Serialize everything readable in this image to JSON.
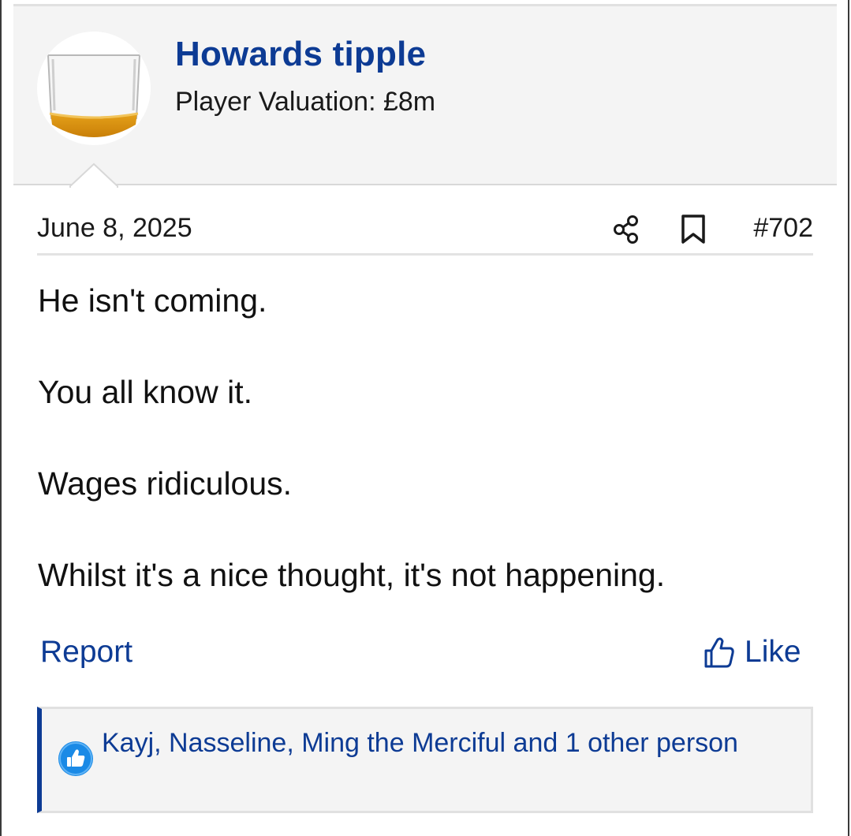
{
  "user": {
    "name": "Howards tipple",
    "title": "Player Valuation: £8m",
    "avatar_icon": "whisky-glass-avatar"
  },
  "post": {
    "date": "June 8, 2025",
    "number": "#702",
    "share_icon": "share-icon",
    "bookmark_icon": "bookmark-icon",
    "paragraphs": [
      "He isn't coming.",
      "You all know it.",
      "Wages ridiculous.",
      "Whilst it's a nice thought, it's not happening."
    ]
  },
  "actions": {
    "report_label": "Report",
    "like_label": "Like",
    "like_icon": "thumbs-up-icon"
  },
  "reactions": {
    "icon": "like-reaction-icon",
    "text": "Kayj, Nasseline, Ming the Merciful and 1 other person"
  },
  "colors": {
    "link": "#0d3b94",
    "header_bg": "#f4f4f4",
    "reaction_bg": "#f4f4f4",
    "reaction_icon": "#1a8ae6"
  }
}
